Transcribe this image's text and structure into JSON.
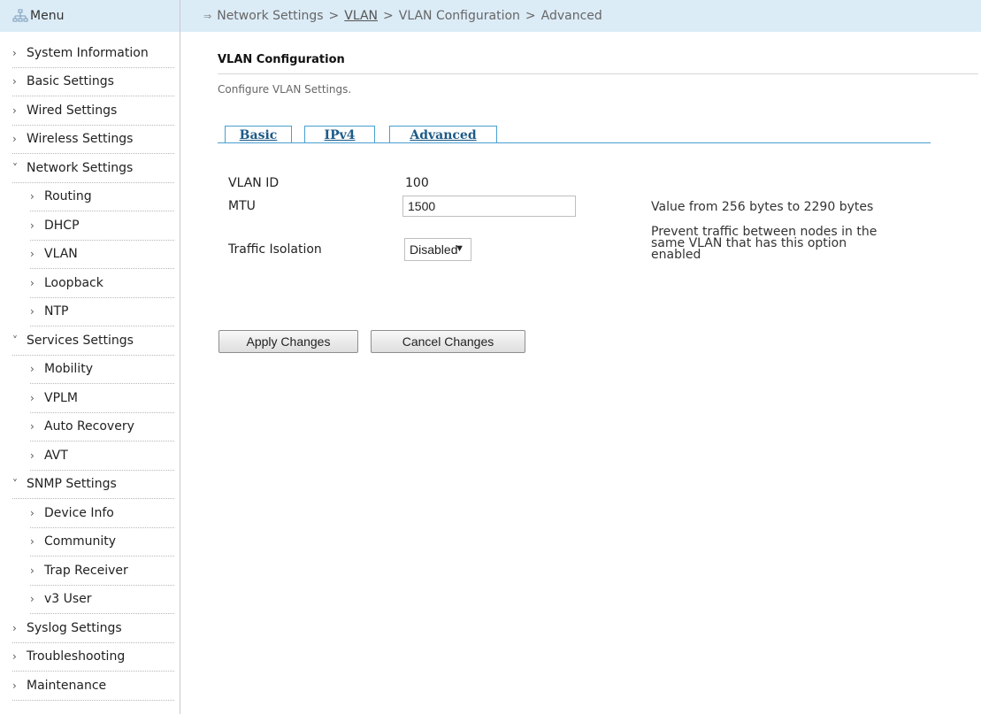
{
  "sidebar": {
    "header": "Menu",
    "items": [
      {
        "label": "System Information",
        "level": 0,
        "expanded": false
      },
      {
        "label": "Basic Settings",
        "level": 0,
        "expanded": false
      },
      {
        "label": "Wired Settings",
        "level": 0,
        "expanded": false
      },
      {
        "label": "Wireless Settings",
        "level": 0,
        "expanded": false
      },
      {
        "label": "Network Settings",
        "level": 0,
        "expanded": true
      },
      {
        "label": "Routing",
        "level": 1,
        "expanded": false
      },
      {
        "label": "DHCP",
        "level": 1,
        "expanded": false
      },
      {
        "label": "VLAN",
        "level": 1,
        "expanded": false
      },
      {
        "label": "Loopback",
        "level": 1,
        "expanded": false
      },
      {
        "label": "NTP",
        "level": 1,
        "expanded": false
      },
      {
        "label": "Services Settings",
        "level": 0,
        "expanded": true
      },
      {
        "label": "Mobility",
        "level": 1,
        "expanded": false
      },
      {
        "label": "VPLM",
        "level": 1,
        "expanded": false
      },
      {
        "label": "Auto Recovery",
        "level": 1,
        "expanded": false
      },
      {
        "label": "AVT",
        "level": 1,
        "expanded": false
      },
      {
        "label": "SNMP Settings",
        "level": 0,
        "expanded": true
      },
      {
        "label": "Device Info",
        "level": 1,
        "expanded": false
      },
      {
        "label": "Community",
        "level": 1,
        "expanded": false
      },
      {
        "label": "Trap Receiver",
        "level": 1,
        "expanded": false
      },
      {
        "label": "v3 User",
        "level": 1,
        "expanded": false
      },
      {
        "label": "Syslog Settings",
        "level": 0,
        "expanded": false
      },
      {
        "label": "Troubleshooting",
        "level": 0,
        "expanded": false
      },
      {
        "label": "Maintenance",
        "level": 0,
        "expanded": false
      }
    ]
  },
  "breadcrumb": {
    "part1": "Network Settings",
    "part2": "VLAN",
    "part3": "VLAN Configuration",
    "part4": "Advanced",
    "separator": ">"
  },
  "page": {
    "title": "VLAN Configuration",
    "description": "Configure VLAN Settings."
  },
  "tabs": {
    "basic": "Basic",
    "ipv4": "IPv4",
    "advanced": "Advanced"
  },
  "form": {
    "vlan_id_label": "VLAN ID",
    "vlan_id_value": "100",
    "mtu_label": "MTU",
    "mtu_value": "1500",
    "mtu_hint": "Value from 256 bytes to 2290 bytes",
    "traffic_label": "Traffic Isolation",
    "traffic_value": "Disabled",
    "traffic_hint_line1": "Prevent traffic between nodes in the",
    "traffic_hint_line2": "same VLAN that has this option",
    "traffic_hint_line3": "enabled"
  },
  "buttons": {
    "apply": "Apply Changes",
    "cancel": "Cancel Changes"
  },
  "colors": {
    "header_bg": "#dcecf7",
    "tab_border": "#4a9fd0",
    "tab_text": "#1d5a86"
  }
}
